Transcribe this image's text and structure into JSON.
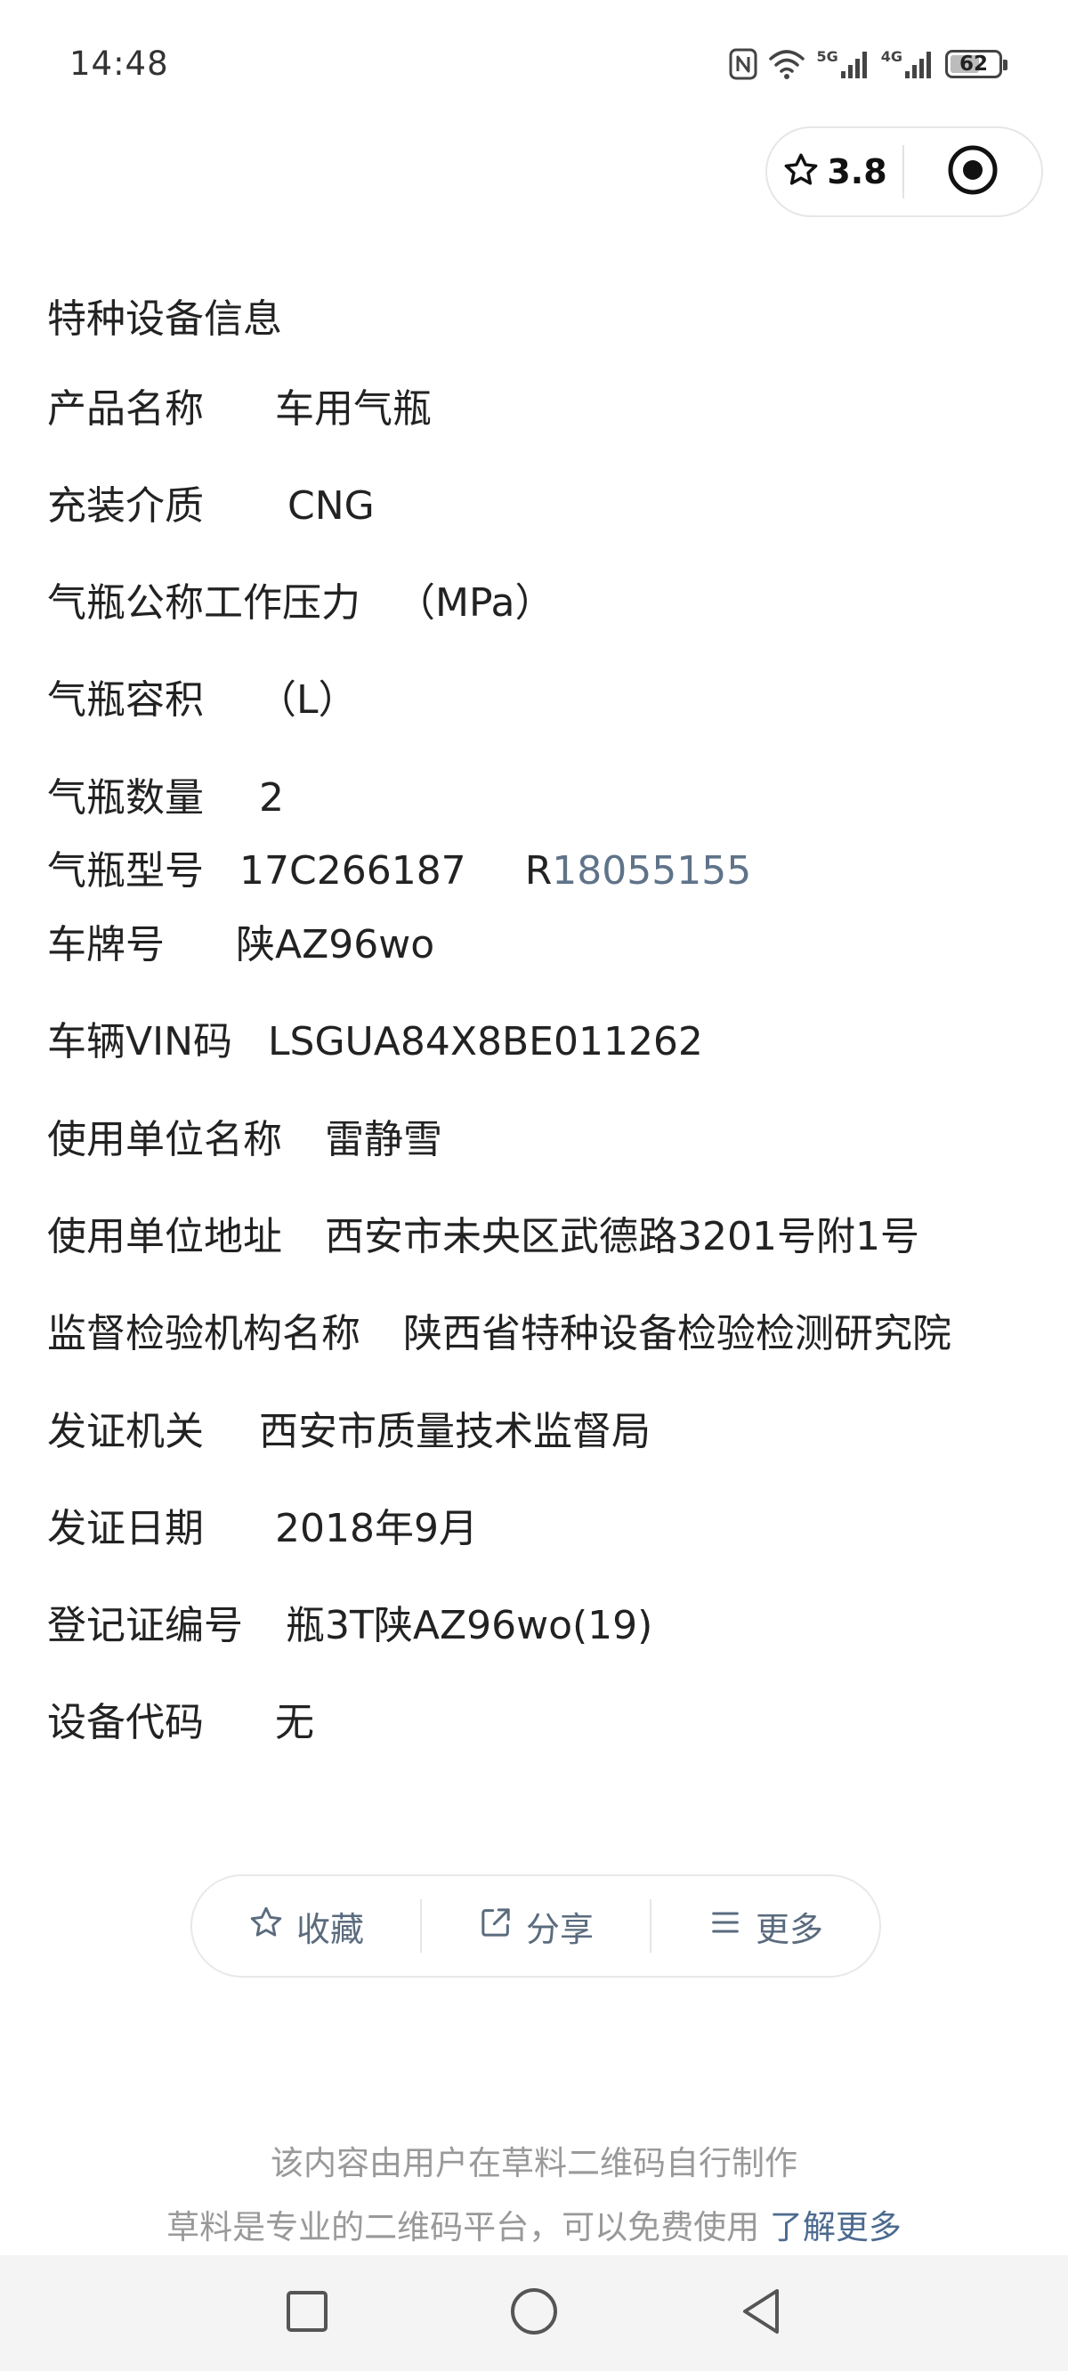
{
  "status_bar": {
    "time": "14:48",
    "signal_label_1": "5G",
    "signal_label_2": "4G",
    "battery_level": 62,
    "battery_text": "62"
  },
  "capsule": {
    "rating": "3.8"
  },
  "info": {
    "section_title": "特种设备信息",
    "rows": [
      {
        "label": "产品名称",
        "value": "车用气瓶"
      },
      {
        "label": "充装介质",
        "value": "CNG"
      },
      {
        "label": "气瓶公称工作压力",
        "value": "（MPa）"
      },
      {
        "label": "气瓶容积",
        "value": "（L）"
      },
      {
        "label": "气瓶数量",
        "value": "2"
      },
      {
        "label": "气瓶型号",
        "value": "17C266187",
        "suffix_prefix": "R",
        "suffix_rest": "18055155"
      },
      {
        "label": "车牌号",
        "value": "陕AZ96wo"
      },
      {
        "label": "车辆VIN码",
        "value": "LSGUA84X8BE011262"
      },
      {
        "label": "使用单位名称",
        "value": "雷静雪"
      },
      {
        "label": "使用单位地址",
        "value": "西安市未央区武德路3201号附1号"
      },
      {
        "label": "监督检验机构名称",
        "value": "陕西省特种设备检验检测研究院"
      },
      {
        "label": "发证机关",
        "value": "西安市质量技术监督局"
      },
      {
        "label": "发证日期",
        "value": "2018年9月"
      },
      {
        "label": "登记证编号",
        "value": "瓶3T陕AZ96wo(19)"
      },
      {
        "label": "设备代码",
        "value": "无"
      }
    ]
  },
  "actions": {
    "favorite": "收藏",
    "share": "分享",
    "more": "更多"
  },
  "footer": {
    "line1": "该内容由用户在草料二维码自行制作",
    "line2": "草料是专业的二维码平台，可以免费使用",
    "link": "了解更多"
  },
  "colors": {
    "accent_link": "#4c6a8f",
    "muted_text": "#999999",
    "action_text": "#5a6b7e"
  }
}
